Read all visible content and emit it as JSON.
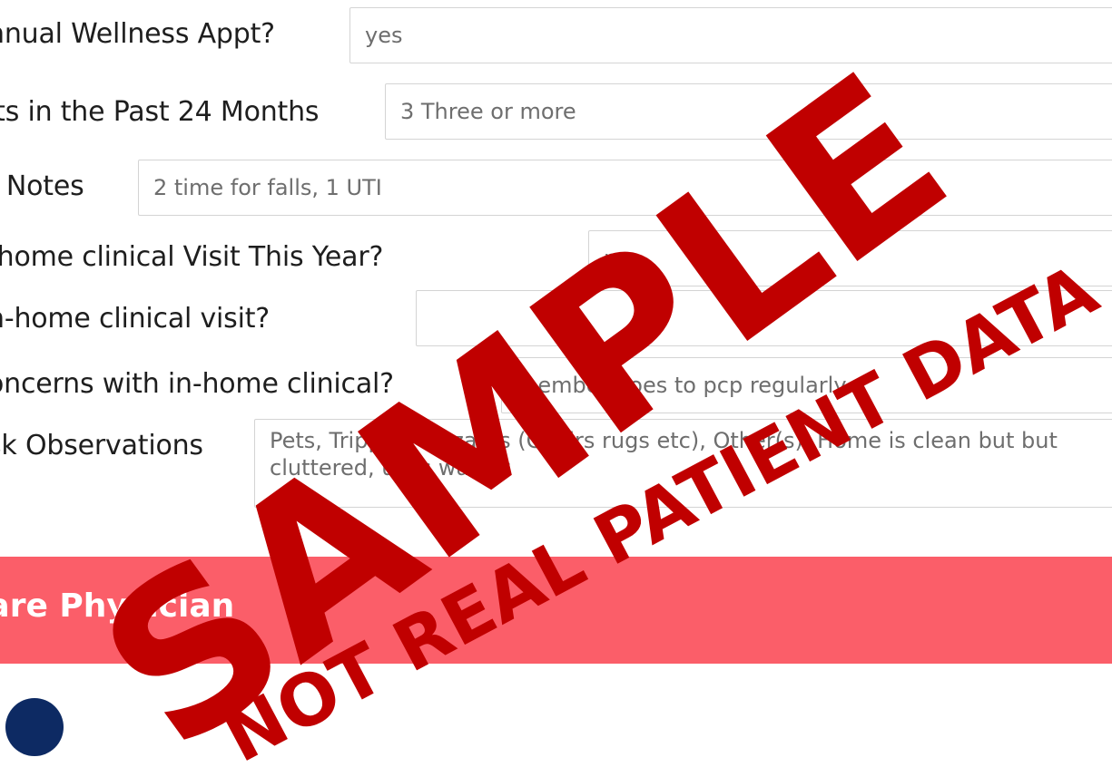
{
  "form": {
    "rows": [
      {
        "label": "nnual Wellness Appt?",
        "value": "yes"
      },
      {
        "label": "its in the Past 24 Months",
        "value": "3 Three or more"
      },
      {
        "label": "t Notes",
        "value": "2 time for falls, 1 UTI"
      },
      {
        "label": "-home clinical Visit This Year?",
        "value": "no"
      },
      {
        "label": "n-home clinical visit?",
        "value": ""
      },
      {
        "label": "oncerns with in-home clinical?",
        "value": "member goes to pcp regularly"
      },
      {
        "label": "sk Observations",
        "value": "Pets, Tripping Hazards (Chairs rugs etc), Other(s), Home is clean but but cluttered, uses walker"
      }
    ]
  },
  "section": {
    "title": "Care Physician"
  },
  "watermark": {
    "main": "SAMPLE",
    "sub": "NOT REAL PATIENT DATA",
    "color": "#c00000"
  },
  "colors": {
    "section_bar": "#fb5e69",
    "avatar": "#0d2a63"
  }
}
